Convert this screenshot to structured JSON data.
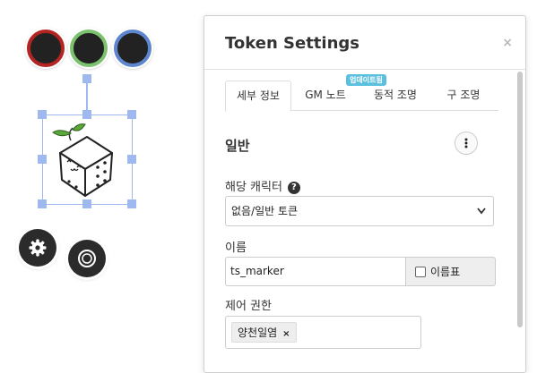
{
  "token_bar": {
    "bubbles": [
      {
        "name": "red",
        "color": "#b22522"
      },
      {
        "name": "green",
        "color": "#7cc16e"
      },
      {
        "name": "blue",
        "color": "#5e86cf"
      }
    ]
  },
  "canvas": {
    "token_icon": "cube-marker-icon",
    "settings_icon": "gear-icon",
    "rotate_icon": "circle-icon"
  },
  "dialog": {
    "title": "Token Settings",
    "close_label": "×",
    "tabs": [
      {
        "label": "세부 정보",
        "active": true
      },
      {
        "label": "GM 노트",
        "active": false
      },
      {
        "label": "동적 조명",
        "active": false
      },
      {
        "label": "구 조명",
        "active": false
      }
    ],
    "update_badge": "업데이트됨",
    "section_title": "일반",
    "character_label": "해당 캐릭터",
    "character_help": "?",
    "character_value": "없음/일반 토큰",
    "name_label": "이름",
    "name_value": "ts_marker",
    "nameplate_label": "이름표",
    "control_label": "제어 권한",
    "control_tags": [
      "양천일염"
    ],
    "tag_remove": "×"
  }
}
